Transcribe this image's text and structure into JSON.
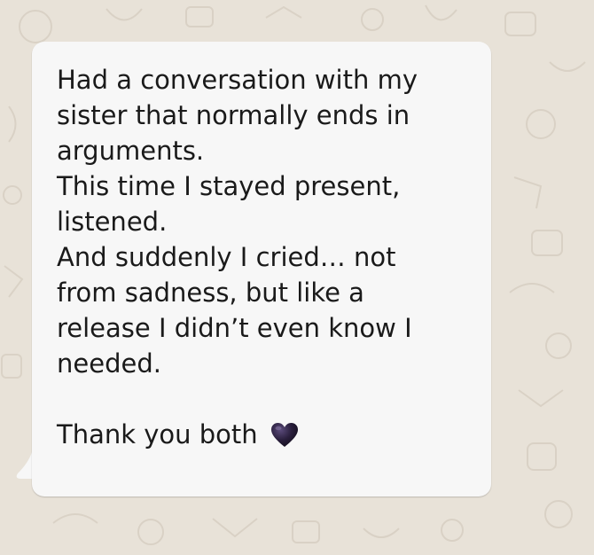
{
  "chat": {
    "message": {
      "lines": [
        "Had a conversation with my",
        "sister that normally ends in",
        "arguments.",
        "This time I stayed present,",
        "listened.",
        "And suddenly I cried… not",
        "from sadness, but like a",
        "release I didn’t even know I",
        "needed."
      ],
      "closing": "Thank you both",
      "emoji_icon": "black-heart-icon"
    },
    "colors": {
      "bubble": "#f7f7f7",
      "wallpaper": "#e8e2d8",
      "text": "#1a1a1a",
      "heart": "#2a1f3d"
    }
  }
}
